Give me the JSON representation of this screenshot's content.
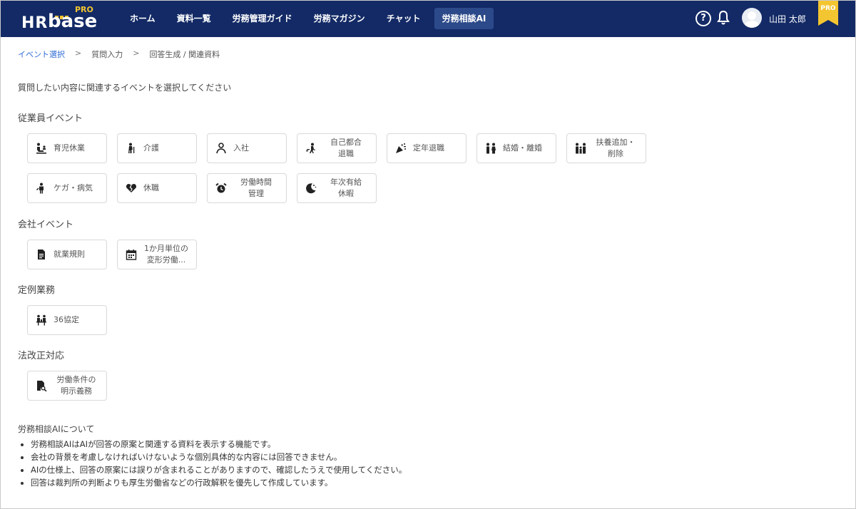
{
  "header": {
    "logo": {
      "hr": "HR",
      "base": "base",
      "pro": "PRO"
    },
    "nav": [
      {
        "label": "ホーム",
        "active": false
      },
      {
        "label": "資料一覧",
        "active": false
      },
      {
        "label": "労務管理ガイド",
        "active": false
      },
      {
        "label": "労務マガジン",
        "active": false
      },
      {
        "label": "チャット",
        "active": false
      },
      {
        "label": "労務相談AI",
        "active": true
      }
    ],
    "user_name": "山田 太郎",
    "badge": "PRO",
    "icons": [
      "help-icon",
      "bell-icon",
      "avatar-icon",
      "pro-badge-icon"
    ]
  },
  "breadcrumb": {
    "items": [
      "イベント選択",
      "質問入力",
      "回答生成 / 関連資料"
    ],
    "separator": ">"
  },
  "instruction": "質問したい内容に関連するイベントを選択してください",
  "sections": [
    {
      "title": "従業員イベント",
      "events": [
        {
          "label": "育児休業",
          "icon": "childcare-icon"
        },
        {
          "label": "介護",
          "icon": "elderly-icon"
        },
        {
          "label": "入社",
          "icon": "person-icon"
        },
        {
          "label": "自己都合\n退職",
          "icon": "walk-out-icon"
        },
        {
          "label": "定年退職",
          "icon": "party-icon"
        },
        {
          "label": "結婚・離婚",
          "icon": "couple-icon"
        },
        {
          "label": "扶養追加・\n削除",
          "icon": "family-icon"
        },
        {
          "label": "ケガ・病気",
          "icon": "injury-icon"
        },
        {
          "label": "休職",
          "icon": "broken-heart-icon"
        },
        {
          "label": "労働時間\n管理",
          "icon": "alarm-icon"
        },
        {
          "label": "年次有給\n休暇",
          "icon": "moon-icon"
        }
      ]
    },
    {
      "title": "会社イベント",
      "events": [
        {
          "label": "就業規則",
          "icon": "document-icon"
        },
        {
          "label": "1か月単位の\n変形労働...",
          "icon": "calendar-icon"
        }
      ]
    },
    {
      "title": "定例業務",
      "events": [
        {
          "label": "36協定",
          "icon": "meeting-icon"
        }
      ]
    },
    {
      "title": "法改正対応",
      "events": [
        {
          "label": "労働条件の\n明示義務",
          "icon": "file-search-icon"
        }
      ]
    }
  ],
  "about": {
    "title": "労務相談AIについて",
    "items": [
      "労務相談AIはAIが回答の原案と関連する資料を表示する機能です。",
      "会社の背景を考慮しなければいけないような個別具体的な内容には回答できません。",
      "AIの仕様上、回答の原案には誤りが含まれることがありますので、確認したうえで使用してください。",
      "回答は裁判所の判断よりも厚生労働省などの行政解釈を優先して作成しています。"
    ]
  },
  "colors": {
    "header_bg": "#132a66",
    "nav_active_bg": "#2c4a8a",
    "breadcrumb_active": "#2f6bd6",
    "logo_accent": "#f3c530"
  }
}
